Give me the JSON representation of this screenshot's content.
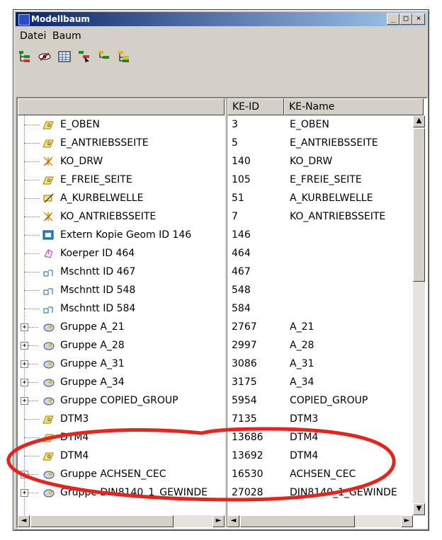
{
  "window": {
    "title": "Modellbaum"
  },
  "title_buttons": {
    "minimize": "_",
    "maximize": "□",
    "close": "×"
  },
  "menu": [
    {
      "label": "Datei"
    },
    {
      "label": "Baum"
    }
  ],
  "toolbar": [
    {
      "icon": "tree-green-icon"
    },
    {
      "icon": "eye-icon"
    },
    {
      "icon": "grid-icon"
    },
    {
      "icon": "select-tree-icon"
    },
    {
      "icon": "tree-yellow-icon"
    },
    {
      "icon": "tree-yellow-alt-icon"
    }
  ],
  "columns": {
    "tree": "",
    "ke_id": "KE-ID",
    "ke_name": "KE-Name"
  },
  "rows": [
    {
      "label": "E_OBEN",
      "id": "3",
      "name": "E_OBEN",
      "icon": "datum-plane-icon",
      "expandable": false
    },
    {
      "label": "E_ANTRIEBSSEITE",
      "id": "5",
      "name": "E_ANTRIEBSSEITE",
      "icon": "datum-plane-icon",
      "expandable": false
    },
    {
      "label": "KO_DRW",
      "id": "140",
      "name": "KO_DRW",
      "icon": "coordinate-system-icon",
      "expandable": false
    },
    {
      "label": "E_FREIE_SEITE",
      "id": "105",
      "name": "E_FREIE_SEITE",
      "icon": "datum-plane-icon",
      "expandable": false
    },
    {
      "label": "A_KURBELWELLE",
      "id": "51",
      "name": "A_KURBELWELLE",
      "icon": "datum-axis-icon",
      "expandable": false
    },
    {
      "label": "KO_ANTRIEBSSEITE",
      "id": "7",
      "name": "KO_ANTRIEBSSEITE",
      "icon": "coordinate-system-icon",
      "expandable": false
    },
    {
      "label": "Extern Kopie Geom ID 146",
      "id": "146",
      "name": "",
      "icon": "extern-copy-icon",
      "expandable": false
    },
    {
      "label": "Koerper ID 464",
      "id": "464",
      "name": "",
      "icon": "body-icon",
      "expandable": false
    },
    {
      "label": "Mschntt ID 467",
      "id": "467",
      "name": "",
      "icon": "cut-icon",
      "expandable": false
    },
    {
      "label": "Mschntt ID 548",
      "id": "548",
      "name": "",
      "icon": "cut-icon",
      "expandable": false
    },
    {
      "label": "Mschntt ID 584",
      "id": "584",
      "name": "",
      "icon": "cut-icon",
      "expandable": false
    },
    {
      "label": "Gruppe A_21",
      "id": "2767",
      "name": "A_21",
      "icon": "group-icon",
      "expandable": true
    },
    {
      "label": "Gruppe A_28",
      "id": "2997",
      "name": "A_28",
      "icon": "group-icon",
      "expandable": true
    },
    {
      "label": "Gruppe A_31",
      "id": "3086",
      "name": "A_31",
      "icon": "group-icon",
      "expandable": true
    },
    {
      "label": "Gruppe A_34",
      "id": "3175",
      "name": "A_34",
      "icon": "group-icon",
      "expandable": true
    },
    {
      "label": "Gruppe COPIED_GROUP",
      "id": "5954",
      "name": "COPIED_GROUP",
      "icon": "group-icon",
      "expandable": true
    },
    {
      "label": "DTM3",
      "id": "7135",
      "name": "DTM3",
      "icon": "datum-plane-icon",
      "expandable": false
    },
    {
      "label": "DTM4",
      "id": "13686",
      "name": "DTM4",
      "icon": "datum-plane-icon",
      "expandable": false
    },
    {
      "label": "DTM4",
      "id": "13692",
      "name": "DTM4",
      "icon": "datum-plane-icon",
      "expandable": false
    },
    {
      "label": "Gruppe ACHSEN_CEC",
      "id": "16530",
      "name": "ACHSEN_CEC",
      "icon": "group-icon",
      "expandable": true
    },
    {
      "label": "Gruppe DIN8140_1_GEWINDE",
      "id": "27028",
      "name": "DIN8140_1_GEWINDE",
      "icon": "group-icon",
      "expandable": true
    }
  ],
  "scrollbar_glyphs": {
    "up": "▲",
    "down": "▼",
    "left": "◄",
    "right": "►"
  },
  "colors": {
    "titlebar_start": "#0a246a",
    "titlebar_end": "#a6caf0",
    "annotation": "#e8231e"
  }
}
